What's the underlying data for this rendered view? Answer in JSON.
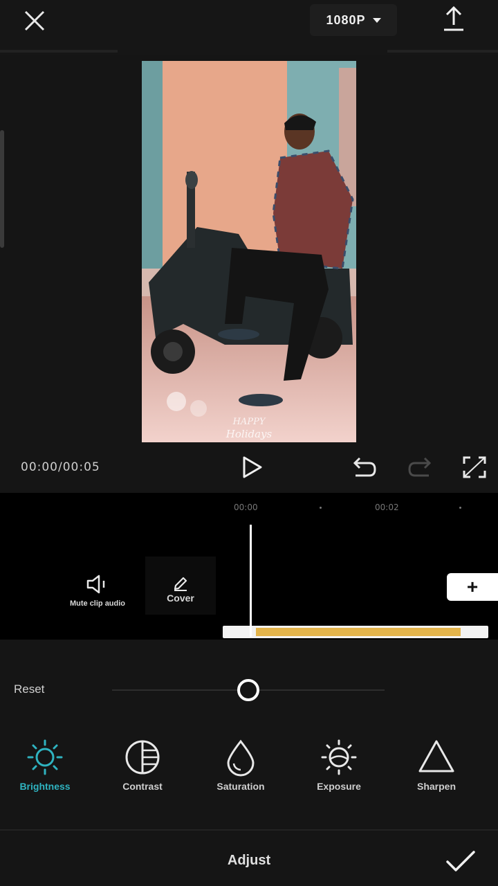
{
  "header": {
    "resolution_label": "1080P",
    "icons": {
      "close": "close-icon",
      "export": "export-icon",
      "caret": "caret-down-icon"
    }
  },
  "preview": {
    "overlay_line1": "HAPPY",
    "overlay_line2": "Holidays"
  },
  "playback": {
    "timecode": "00:00/00:05",
    "icons": {
      "play": "play-icon",
      "undo": "undo-icon",
      "redo": "redo-icon",
      "fullscreen": "fullscreen-icon"
    }
  },
  "timeline": {
    "ticks": [
      "00:00",
      "00:02"
    ],
    "tools": [
      {
        "label": "Mute clip audio",
        "icon": "speaker-icon"
      },
      {
        "label": "Cover",
        "icon": "pencil-icon"
      }
    ],
    "add_icon": "plus-icon"
  },
  "adjust": {
    "reset_label": "Reset",
    "slider_value_fraction": 0.5,
    "items": [
      {
        "label": "Brightness",
        "icon": "sun-icon",
        "active": true
      },
      {
        "label": "Contrast",
        "icon": "contrast-icon",
        "active": false
      },
      {
        "label": "Saturation",
        "icon": "drop-icon",
        "active": false
      },
      {
        "label": "Exposure",
        "icon": "exposure-icon",
        "active": false
      },
      {
        "label": "Sharpen",
        "icon": "triangle-icon",
        "active": false
      }
    ],
    "accent_color": "#2fb3c0"
  },
  "footer": {
    "title": "Adjust",
    "confirm_icon": "check-icon"
  }
}
